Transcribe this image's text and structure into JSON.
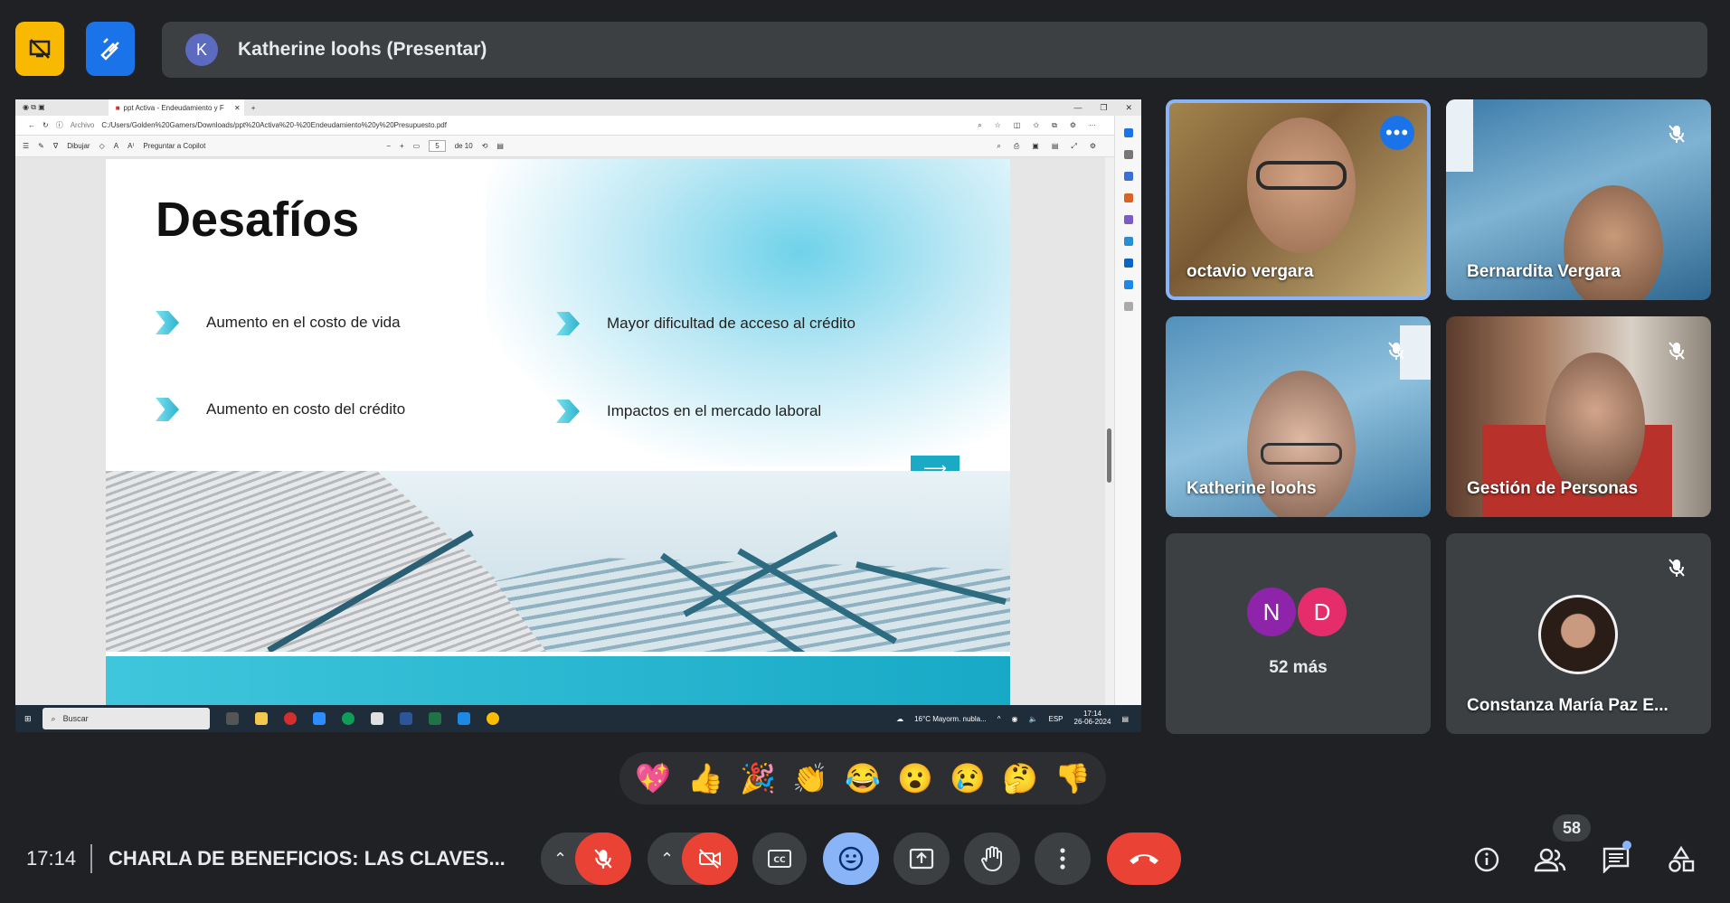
{
  "top": {
    "presenter_initial": "K",
    "presenter_label": "Katherine loohs (Presentar)"
  },
  "shared_screen": {
    "tab_title": "ppt Activa - Endeudamiento y F",
    "address_prefix": "Archivo",
    "address": "C:/Users/Golden%20Gamers/Downloads/ppt%20Activa%20-%20Endeudamiento%20y%20Presupuesto.pdf",
    "toolbar_draw": "Dibujar",
    "toolbar_copilot": "Preguntar a Copilot",
    "page_current": "5",
    "page_total": "de 10",
    "slide": {
      "title": "Desafíos",
      "bullets": [
        "Aumento en el costo de vida",
        "Mayor dificultad de acceso al crédito",
        "Aumento en costo del crédito",
        "Impactos en el mercado laboral"
      ],
      "arrow": "⟶"
    },
    "taskbar": {
      "search": "Buscar",
      "weather": "16°C  Mayorm. nubla...",
      "lang": "ESP",
      "time": "17:14",
      "date": "26-06-2024"
    }
  },
  "participants": [
    {
      "name": "octavio vergara",
      "speaking": true
    },
    {
      "name": "Bernardita Vergara",
      "muted": true
    },
    {
      "name": "Katherine loohs",
      "muted": true
    },
    {
      "name": "Gestión de Personas",
      "muted": true
    },
    {
      "others_initials": [
        "N",
        "D"
      ],
      "others_label": "52 más"
    },
    {
      "name": "Constanza María Paz E...",
      "muted": true
    }
  ],
  "reactions": [
    "💖",
    "👍",
    "🎉",
    "👏",
    "😂",
    "😮",
    "😢",
    "🤔",
    "👎"
  ],
  "bottom": {
    "time": "17:14",
    "meeting_title": "CHARLA DE BENEFICIOS: LAS CLAVES...",
    "people_count": "58"
  },
  "colors": {
    "background": "#202124",
    "panel": "#3c4043",
    "danger": "#ea4335",
    "accent": "#8ab4f8",
    "yellow_button": "#f9b801",
    "blue_button": "#1a73e8"
  }
}
